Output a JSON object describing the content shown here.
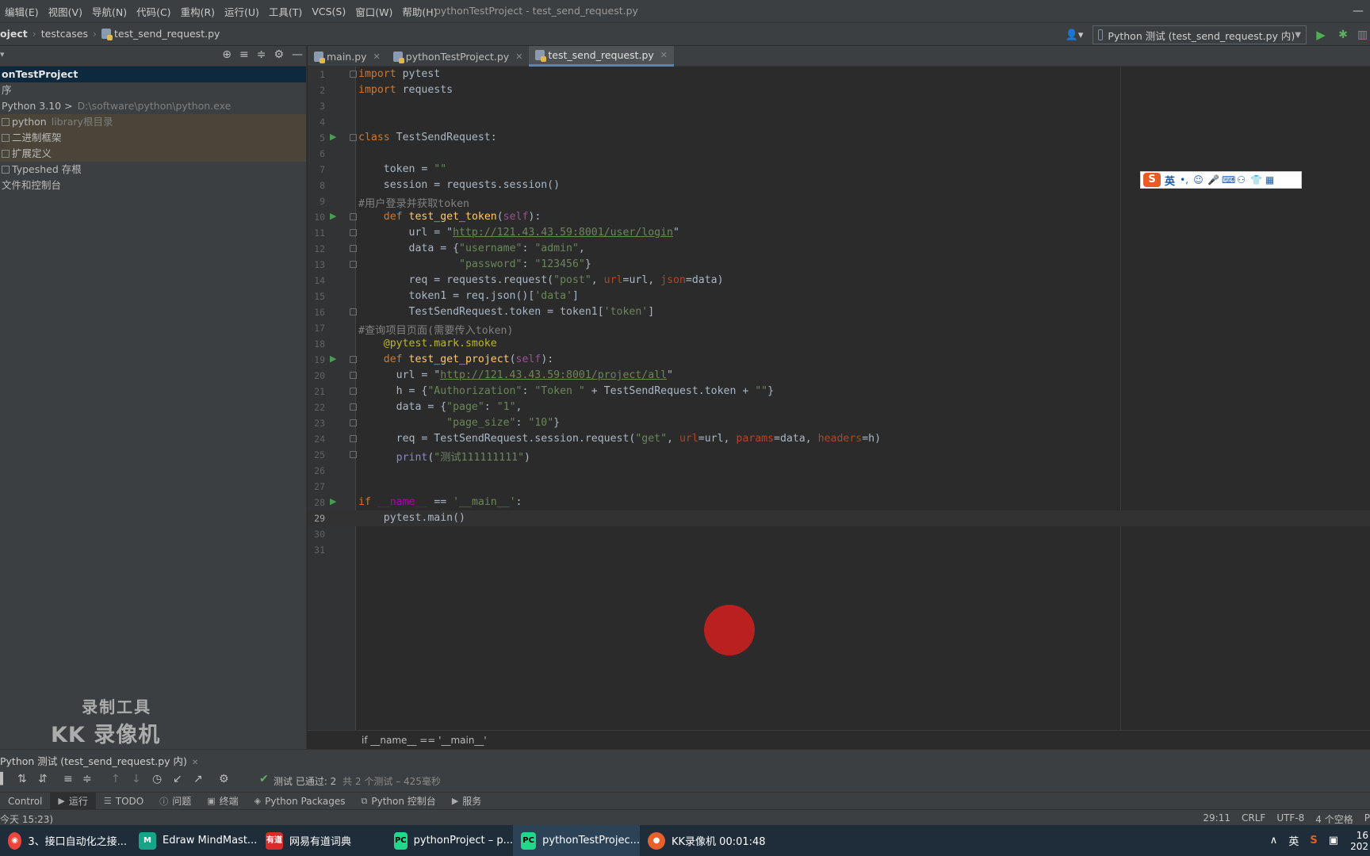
{
  "menu": {
    "items": [
      "编辑(E)",
      "视图(V)",
      "导航(N)",
      "代码(C)",
      "重构(R)",
      "运行(U)",
      "工具(T)",
      "VCS(S)",
      "窗口(W)",
      "帮助(H)"
    ],
    "window_title": "pythonTestProject - test_send_request.py"
  },
  "window_controls": {
    "minimize": "—"
  },
  "navbar": {
    "breadcrumb": [
      "oject",
      "testcases",
      "test_send_request.py"
    ],
    "user_icon": "user-icon",
    "run_config": "Python 测试 (test_send_request.py 内)"
  },
  "project": {
    "tree": [
      {
        "label": "onTestProject",
        "extra": ""
      },
      {
        "label": "序",
        "extra": ""
      },
      {
        "label": "Python 3.10 >",
        "extra": "D:\\software\\python\\python.exe"
      },
      {
        "label": "python",
        "extra": "library根目录"
      },
      {
        "label": "二进制框架",
        "extra": ""
      },
      {
        "label": "扩展定义",
        "extra": ""
      },
      {
        "label": "Typeshed 存根",
        "extra": ""
      },
      {
        "label": "文件和控制台",
        "extra": ""
      }
    ]
  },
  "watermark": {
    "line1": "录制工具",
    "line2": "KK 录像机"
  },
  "editor": {
    "tabs": [
      "main.py",
      "pythonTestProject.py",
      "test_send_request.py"
    ],
    "active_tab": 2,
    "current_line": 29,
    "breadcrumb": "if __name__ == '__main__'",
    "lines": [
      {
        "n": "1",
        "text": "import pytest"
      },
      {
        "n": "2",
        "text": "import requests"
      },
      {
        "n": "3",
        "text": ""
      },
      {
        "n": "4",
        "text": ""
      },
      {
        "n": "5",
        "text": "class TestSendRequest:"
      },
      {
        "n": "6",
        "text": ""
      },
      {
        "n": "7",
        "text": "    token = \"\""
      },
      {
        "n": "8",
        "text": "    session = requests.session()"
      },
      {
        "n": "9",
        "text": "#用户登录并获取token"
      },
      {
        "n": "10",
        "text": "    def test_get_token(self):"
      },
      {
        "n": "11",
        "text": "        url = \"http://121.43.43.59:8001/user/login\""
      },
      {
        "n": "12",
        "text": "        data = {\"username\": \"admin\","
      },
      {
        "n": "13",
        "text": "                \"password\": \"123456\"}"
      },
      {
        "n": "14",
        "text": "        req = requests.request(\"post\", url=url, json=data)"
      },
      {
        "n": "15",
        "text": "        token1 = req.json()['data']"
      },
      {
        "n": "16",
        "text": "        TestSendRequest.token = token1['token']"
      },
      {
        "n": "17",
        "text": "#查询项目页面(需要传入token)"
      },
      {
        "n": "18",
        "text": "    @pytest.mark.smoke"
      },
      {
        "n": "19",
        "text": "    def test_get_project(self):"
      },
      {
        "n": "20",
        "text": "      url = \"http://121.43.43.59:8001/project/all\""
      },
      {
        "n": "21",
        "text": "      h = {\"Authorization\": \"Token \" + TestSendRequest.token + \"\"}"
      },
      {
        "n": "22",
        "text": "      data = {\"page\": \"1\","
      },
      {
        "n": "23",
        "text": "              \"page_size\": \"10\"}"
      },
      {
        "n": "24",
        "text": "      req = TestSendRequest.session.request(\"get\", url=url, params=data, headers=h)"
      },
      {
        "n": "25",
        "text": "      print(\"测试111111111\")"
      },
      {
        "n": "26",
        "text": ""
      },
      {
        "n": "27",
        "text": ""
      },
      {
        "n": "28",
        "text": "if __name__ == '__main__':"
      },
      {
        "n": "29",
        "text": "    pytest.main()"
      },
      {
        "n": "30",
        "text": ""
      },
      {
        "n": "31",
        "text": ""
      }
    ]
  },
  "ime": {
    "logo": "S",
    "lang": "英"
  },
  "run_panel": {
    "tab": "Python 测试 (test_send_request.py 内)",
    "status_passed": "测试 已通过: 2",
    "status_detail": "共 2 个测试 – 425毫秒"
  },
  "toolwindows": [
    "Control",
    "运行",
    "TODO",
    "问题",
    "终端",
    "Python Packages",
    "Python 控制台",
    "服务"
  ],
  "statusbar": {
    "left": "今天 15:23)",
    "position": "29:11",
    "line_sep": "CRLF",
    "encoding": "UTF-8",
    "indent": "4 个空格",
    "extra": "P"
  },
  "taskbar": {
    "items": [
      {
        "label": "3、接口自动化之接...",
        "active": false
      },
      {
        "label": "Edraw MindMast...",
        "active": false
      },
      {
        "label": "网易有道词典",
        "active": false
      },
      {
        "label": "pythonProject – p...",
        "active": false
      },
      {
        "label": "pythonTestProjec...",
        "active": true
      },
      {
        "label": "KK录像机 00:01:48",
        "active": false
      }
    ],
    "tray_lang": "英",
    "clock_time": "16",
    "clock_date": "202"
  }
}
